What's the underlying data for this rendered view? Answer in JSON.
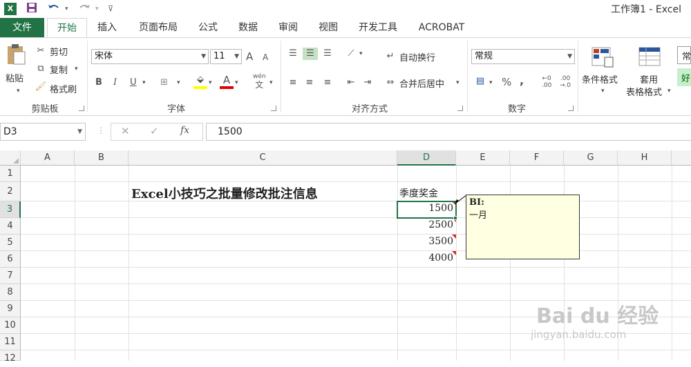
{
  "window": {
    "title": "工作簿1 - Excel",
    "app_icon": "X"
  },
  "tabs": [
    {
      "label": "文件"
    },
    {
      "label": "开始"
    },
    {
      "label": "插入"
    },
    {
      "label": "页面布局"
    },
    {
      "label": "公式"
    },
    {
      "label": "数据"
    },
    {
      "label": "审阅"
    },
    {
      "label": "视图"
    },
    {
      "label": "开发工具"
    },
    {
      "label": "ACROBAT"
    }
  ],
  "ribbon": {
    "clipboard": {
      "paste": "粘贴",
      "cut": "剪切",
      "copy": "复制",
      "format_painter": "格式刷",
      "label": "剪贴板"
    },
    "font": {
      "name": "宋体",
      "size": "11",
      "label": "字体",
      "bold": "B",
      "italic": "I",
      "underline": "U",
      "grow": "A",
      "shrink": "A",
      "font_color": "A",
      "phonetic_top": "wén",
      "phonetic": "文"
    },
    "alignment": {
      "wrap": "自动换行",
      "merge": "合并后居中",
      "label": "对齐方式"
    },
    "number": {
      "format": "常规",
      "percent": "%",
      "comma": ",",
      "inc_decimal_top": "←0",
      "inc_decimal_bottom": ".00",
      "dec_decimal_top": ".00",
      "dec_decimal_bottom": "→.0",
      "label": "数字"
    },
    "styles": {
      "conditional": "条件格式",
      "table_line1": "套用",
      "table_line2": "表格格式",
      "style_normal": "常",
      "style_good": "好"
    }
  },
  "formula_bar": {
    "name_box": "D3",
    "cancel": "✕",
    "enter": "✓",
    "fx": "fx",
    "value": "1500"
  },
  "grid": {
    "columns": [
      "A",
      "B",
      "C",
      "D",
      "E",
      "F",
      "G",
      "H"
    ],
    "rows": [
      "1",
      "2",
      "3",
      "4",
      "5",
      "6",
      "7",
      "8",
      "9",
      "10",
      "11",
      "12"
    ],
    "title": "Excel小技巧之批量修改批注信息",
    "header_d2": "季度奖金",
    "values": [
      "1500",
      "2500",
      "3500",
      "4000"
    ]
  },
  "comment": {
    "author": "BI:",
    "text": "一月"
  },
  "watermark": {
    "brand": "Bai du 经验",
    "url": "jingyan.baidu.com"
  },
  "colors": {
    "accent": "#217346",
    "comment_bg": "#ffffe1",
    "comment_marker": "#d9261c"
  }
}
